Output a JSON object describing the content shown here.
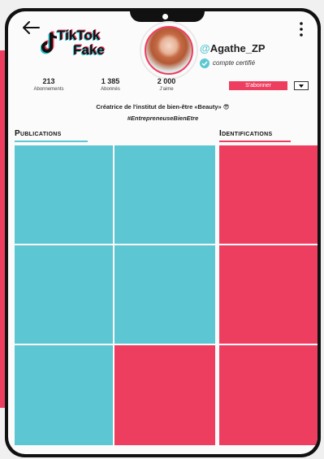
{
  "app": {
    "logo_line1": "TikTok",
    "logo_line2": "Fake"
  },
  "profile": {
    "username_at": "@",
    "username": "Agathe_ZP",
    "certified": "compte certifié"
  },
  "stats": [
    {
      "value": "213",
      "label": "Abonnements"
    },
    {
      "value": "1 385",
      "label": "Abonnés"
    },
    {
      "value": "2 000",
      "label": "J'aime"
    }
  ],
  "actions": {
    "subscribe_label": "S'abonner"
  },
  "bio": {
    "line1": "Créatrice de l'institut de bien-être «Beauty» 😎",
    "line2": "#EntrepreneuseBienEtre"
  },
  "sections": {
    "publications": "Publications",
    "identifications": "Identifications"
  },
  "colors": {
    "accent_cyan": "#5cc7d2",
    "accent_pink": "#ee3e60"
  },
  "grid": {
    "publications": [
      "cyan",
      "cyan",
      "cyan",
      "cyan",
      "cyan",
      "pink"
    ],
    "identifications": [
      "pink",
      "pink",
      "pink"
    ]
  }
}
